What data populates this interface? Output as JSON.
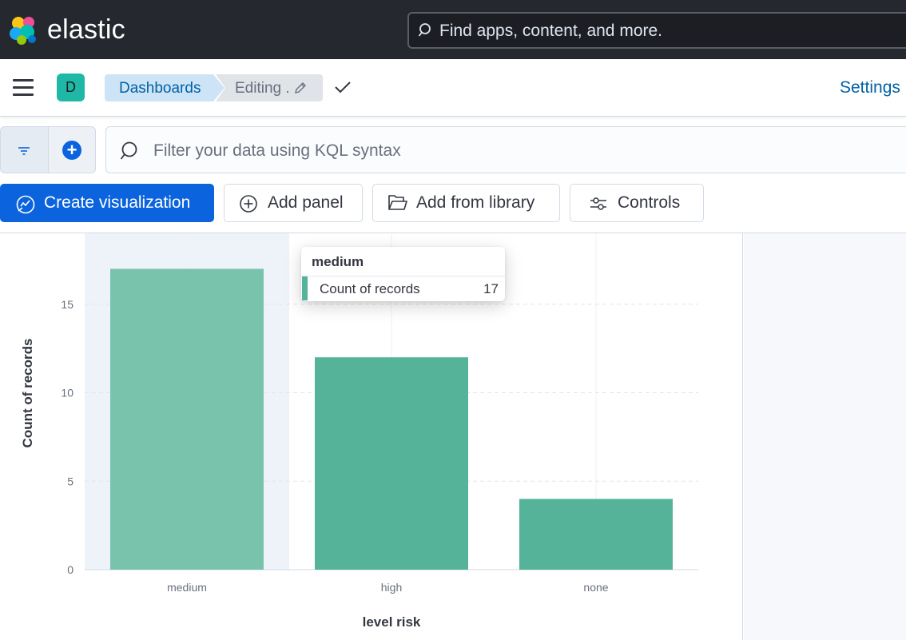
{
  "header": {
    "brand": "elastic",
    "search_placeholder": "Find apps, content, and more."
  },
  "nav": {
    "space_initial": "D",
    "breadcrumbs": [
      "Dashboards",
      "Editing ."
    ],
    "settings_label": "Settings"
  },
  "query": {
    "placeholder": "Filter your data using KQL syntax"
  },
  "toolbar": {
    "create_label": "Create visualization",
    "add_panel_label": "Add panel",
    "add_library_label": "Add from library",
    "controls_label": "Controls"
  },
  "tooltip": {
    "title": "medium",
    "series": "Count of records",
    "value": "17"
  },
  "colors": {
    "bar": "#54b399",
    "bar_highlight": "#79c3ad",
    "hover_band": "#eef2f9",
    "accent": "#0b64dd"
  },
  "chart_data": {
    "type": "bar",
    "categories": [
      "medium",
      "high",
      "none"
    ],
    "values": [
      17,
      12,
      4
    ],
    "xlabel": "level risk",
    "ylabel": "Count of records",
    "ylim": [
      0,
      18
    ],
    "yticks": [
      0,
      5,
      10,
      15
    ],
    "grid": true,
    "highlighted_category": "medium"
  }
}
